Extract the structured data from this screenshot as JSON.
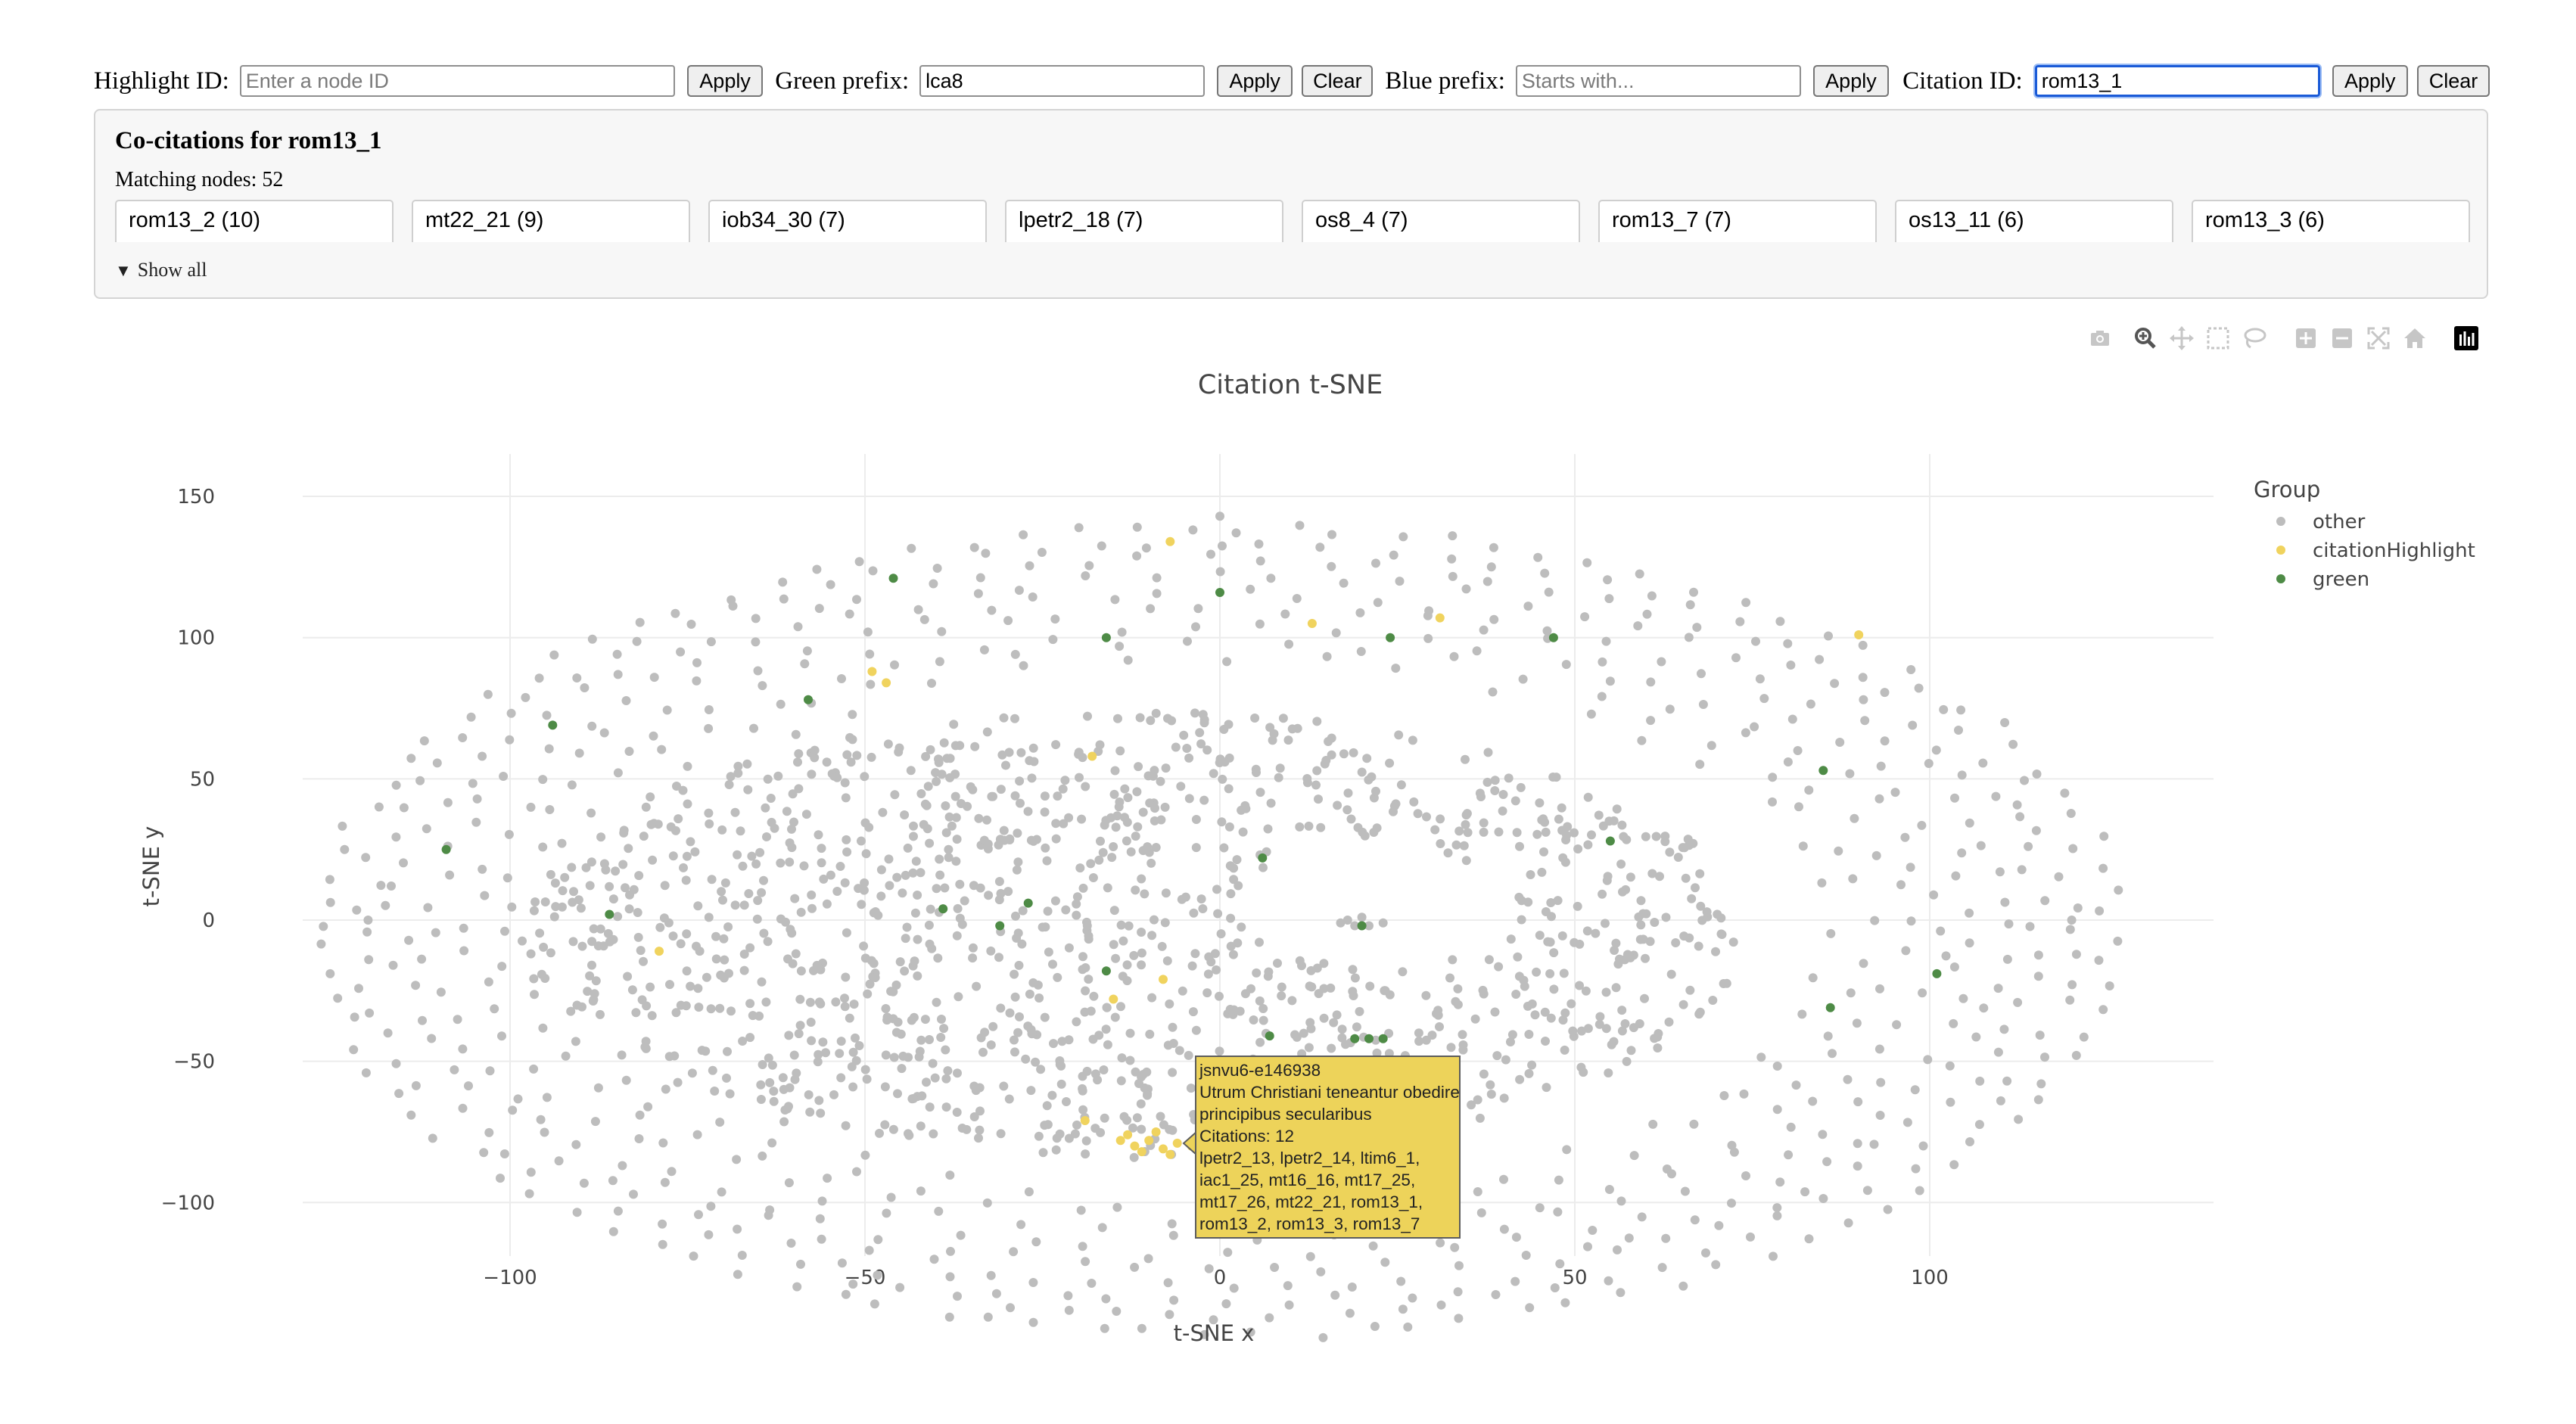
{
  "toolbar": {
    "highlight_label": "Highlight ID:",
    "highlight_placeholder": "Enter a node ID",
    "highlight_value": "",
    "apply_label": "Apply",
    "green_label": "Green prefix:",
    "green_value": "lca8",
    "clear_label": "Clear",
    "blue_label": "Blue prefix:",
    "blue_placeholder": "Starts with...",
    "blue_value": "",
    "citation_label": "Citation ID:",
    "citation_value": "rom13_1"
  },
  "panel": {
    "title": "Co-citations for rom13_1",
    "matching": "Matching nodes: 52",
    "chips": [
      "rom13_2 (10)",
      "mt22_21 (9)",
      "iob34_30 (7)",
      "lpetr2_18 (7)",
      "os8_4 (7)",
      "rom13_7 (7)",
      "os13_11 (6)",
      "rom13_3 (6)"
    ],
    "show_all": "Show all"
  },
  "modebar": {
    "icons": [
      "camera-icon",
      "zoom-icon",
      "pan-icon",
      "box-select-icon",
      "lasso-select-icon",
      "zoom-in-icon",
      "zoom-out-icon",
      "autoscale-icon",
      "reset-axes-icon",
      "plotly-logo-icon"
    ]
  },
  "chart_data": {
    "type": "scatter",
    "title": "Citation t-SNE",
    "xlabel": "t-SNE x",
    "ylabel": "t-SNE y",
    "xlim": [
      -127,
      128
    ],
    "ylim": [
      -110,
      158
    ],
    "x_ticks": [
      -100,
      -50,
      0,
      50,
      100
    ],
    "y_ticks": [
      -100,
      -50,
      0,
      50,
      100,
      150
    ],
    "x_tick_labels": [
      "−100",
      "−50",
      "0",
      "50",
      "100"
    ],
    "y_tick_labels": [
      "−100",
      "−50",
      "0",
      "50",
      "100",
      "150"
    ],
    "grid": true,
    "legend": {
      "title": "Group",
      "position": "top-right",
      "entries": [
        {
          "name": "other",
          "color": "#bdbdbd"
        },
        {
          "name": "citationHighlight",
          "color": "#f0d35e"
        },
        {
          "name": "green",
          "color": "#4e8b46"
        }
      ]
    },
    "series": [
      {
        "name": "other",
        "color": "#bdbdbd",
        "note_points": "about 2000 points spread in an elliptical ring approx. x in [-127,128], y in [-105,143], sparse hole near (20,0)",
        "points": [
          [
            17,
            -1
          ],
          [
            19,
            -2
          ],
          [
            21,
            -2
          ],
          [
            23,
            -1
          ],
          [
            18,
            0
          ],
          [
            20,
            1
          ],
          [
            -120,
            0
          ],
          [
            120,
            0
          ],
          [
            0,
            143
          ],
          [
            0,
            -105
          ]
        ]
      },
      {
        "name": "citationHighlight",
        "color": "#f0d35e",
        "points": [
          [
            -7,
            134
          ],
          [
            -49,
            88
          ],
          [
            -47,
            84
          ],
          [
            13,
            105
          ],
          [
            31,
            107
          ],
          [
            90,
            101
          ],
          [
            -18,
            58
          ],
          [
            -79,
            -11
          ],
          [
            -15,
            -28
          ],
          [
            -8,
            -21
          ],
          [
            -19,
            -71
          ],
          [
            -14,
            -78
          ],
          [
            -12,
            -80
          ],
          [
            -10,
            -78
          ],
          [
            -8,
            -81
          ],
          [
            -6,
            -79
          ],
          [
            -4,
            -80
          ],
          [
            -2,
            -78
          ],
          [
            -9,
            -75
          ],
          [
            -13,
            -76
          ],
          [
            -11,
            -82
          ],
          [
            -7,
            -83
          ],
          [
            -3,
            -76
          ]
        ]
      },
      {
        "name": "green",
        "color": "#4e8b46",
        "points": [
          [
            -46,
            121
          ],
          [
            0,
            116
          ],
          [
            -16,
            100
          ],
          [
            24,
            100
          ],
          [
            47,
            100
          ],
          [
            -94,
            69
          ],
          [
            -58,
            78
          ],
          [
            85,
            53
          ],
          [
            -109,
            25
          ],
          [
            6,
            22
          ],
          [
            55,
            28
          ],
          [
            -86,
            2
          ],
          [
            -39,
            4
          ],
          [
            -27,
            6
          ],
          [
            -31,
            -2
          ],
          [
            -16,
            -18
          ],
          [
            20,
            -2
          ],
          [
            101,
            -19
          ],
          [
            86,
            -31
          ],
          [
            7,
            -41
          ],
          [
            19,
            -42
          ],
          [
            21,
            -42
          ],
          [
            23,
            -42
          ]
        ]
      }
    ]
  },
  "tooltip": {
    "lines": [
      "jsnvu6-e146938",
      "Utrum Christiani teneantur obedire",
      "principibus secularibus",
      "Citations: 12",
      "lpetr2_13, lpetr2_14, ltim6_1,",
      "iac1_25, mt16_16, mt17_25,",
      "mt17_26, mt22_21, rom13_1,",
      "rom13_2, rom13_3, rom13_7"
    ]
  }
}
